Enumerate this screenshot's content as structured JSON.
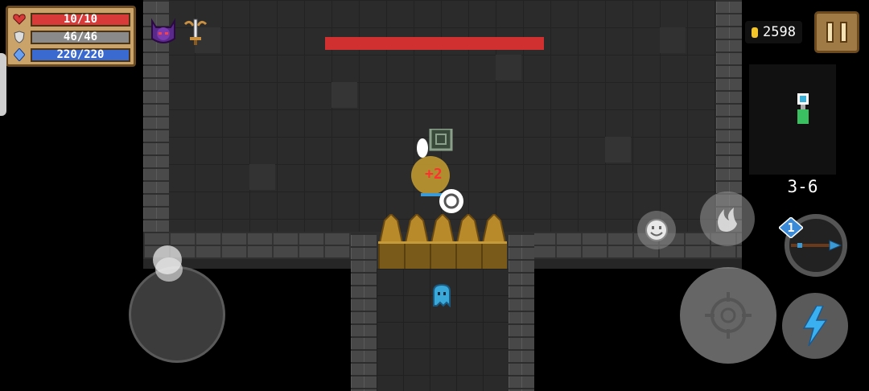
{
  "stats": {
    "hp": "10/10",
    "armor": "46/46",
    "energy": "220/220",
    "hp_fraction": 1.0,
    "armor_fraction": 1.0,
    "energy_fraction": 1.0
  },
  "buffs": [
    "demon-helmet-icon",
    "sword-buff-icon"
  ],
  "boss": {
    "health_fraction": 1.0,
    "bar_color": "#d03030"
  },
  "coins": "2598",
  "level": "3-6",
  "weapon": {
    "energy_cost": "1",
    "icon": "spear-icon"
  },
  "damage_popup": "+2",
  "colors": {
    "hp": "#d83a3a",
    "armor": "#8a8a8a",
    "energy": "#3a6ad0",
    "coin": "#f3c52b",
    "ghost": "#3aa8d8"
  },
  "controls": [
    "joystick",
    "emote-button",
    "skill-button",
    "attack-button",
    "weapon-switch-button",
    "lightning-button"
  ]
}
